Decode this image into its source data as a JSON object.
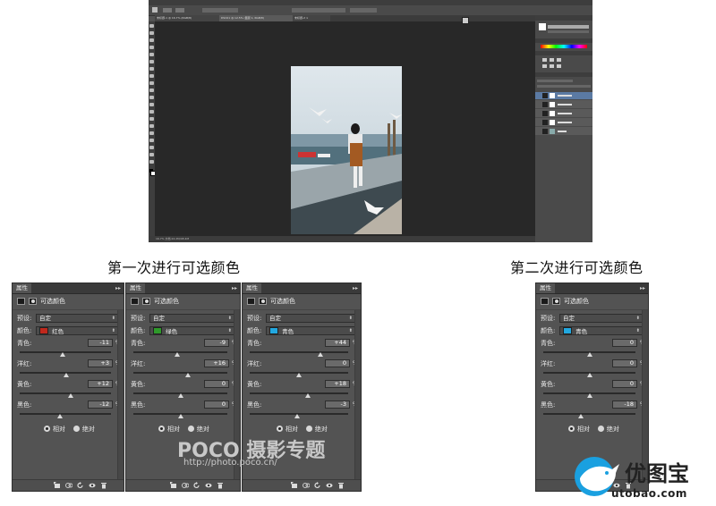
{
  "ps": {
    "tabs": [
      "未标题-1 @ 16.7% (RGB/8)",
      "DSC01 @ 12.5% (图层 1, RGB/8)",
      "未标题-2 ×"
    ],
    "status": "16.7%  文档:24.2M/48.4M",
    "layer_names": [
      "选取颜色 1",
      "选取颜色 2",
      "选取颜色 3",
      "选取颜色 4",
      "背景"
    ]
  },
  "headings": {
    "first": "第一次进行可选颜色",
    "second": "第二次进行可选颜色"
  },
  "panel_common": {
    "tab_label": "属性",
    "collapse": "▸▸",
    "title": "可选颜色",
    "preset_label": "预设:",
    "preset_value": "自定",
    "color_label": "颜色:",
    "field_labels": [
      "青色:",
      "洋红:",
      "黄色:",
      "黑色:"
    ],
    "pct": "%",
    "radio_relative": "相对",
    "radio_absolute": "绝对"
  },
  "panels": [
    {
      "color_name": "红色",
      "swatch": "#c0281c",
      "values": [
        "-11",
        "+3",
        "+12",
        "-12"
      ],
      "thumbs": [
        0.47,
        0.51,
        0.56,
        0.44
      ]
    },
    {
      "color_name": "绿色",
      "swatch": "#2e9a2a",
      "values": [
        "-9",
        "+16",
        "0",
        "0"
      ],
      "thumbs": [
        0.47,
        0.58,
        0.5,
        0.5
      ]
    },
    {
      "color_name": "青色",
      "swatch": "#22a8e0",
      "values": [
        "+44",
        "0",
        "+18",
        "-3"
      ],
      "thumbs": [
        0.72,
        0.5,
        0.59,
        0.48
      ]
    },
    {
      "color_name": "青色",
      "swatch": "#22a8e0",
      "values": [
        "0",
        "0",
        "0",
        "-18"
      ],
      "thumbs": [
        0.5,
        0.5,
        0.5,
        0.41
      ]
    }
  ],
  "watermarks": {
    "poco": "POCO 摄影专题",
    "poco_url": "http://photo.poco.cn/",
    "utobao": "优图宝",
    "utobao_url": "utobao.com"
  },
  "colors": {
    "ps_bg": "#535353",
    "panel_bg": "#535353",
    "accent_layer": "#5b7aa3"
  }
}
